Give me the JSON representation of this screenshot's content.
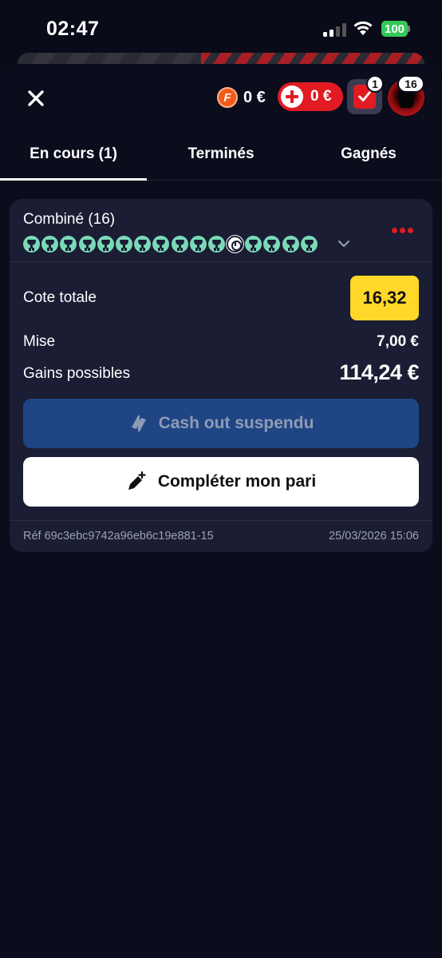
{
  "status_bar": {
    "time": "02:47",
    "battery": "100"
  },
  "header": {
    "freebet_amount": "0 €",
    "freebet_letter": "F",
    "bonus_amount": "0 €",
    "betslip_count": "1",
    "avatar_count": "16"
  },
  "tabs": [
    {
      "label": "En cours (1)",
      "active": true
    },
    {
      "label": "Terminés",
      "active": false
    },
    {
      "label": "Gagnés",
      "active": false
    }
  ],
  "bet": {
    "title": "Combiné (16)",
    "legs": [
      "won",
      "won",
      "won",
      "won",
      "won",
      "won",
      "won",
      "won",
      "won",
      "won",
      "won",
      "pending",
      "won",
      "won",
      "won",
      "won"
    ],
    "total_odds_label": "Cote totale",
    "total_odds": "16,32",
    "stake_label": "Mise",
    "stake": "7,00 €",
    "gains_label": "Gains possibles",
    "gains": "114,24 €",
    "cashout_label": "Cash out suspendu",
    "complete_label": "Compléter mon pari",
    "reference": "Réf 69c3ebc9742a96eb6c19e881-15",
    "date": "25/03/2026 15:06"
  },
  "colors": {
    "accent_red": "#e21b23",
    "odds_yellow": "#ffd829",
    "leg_won": "#7ad9b7",
    "cashout_blue": "#1f4585"
  }
}
